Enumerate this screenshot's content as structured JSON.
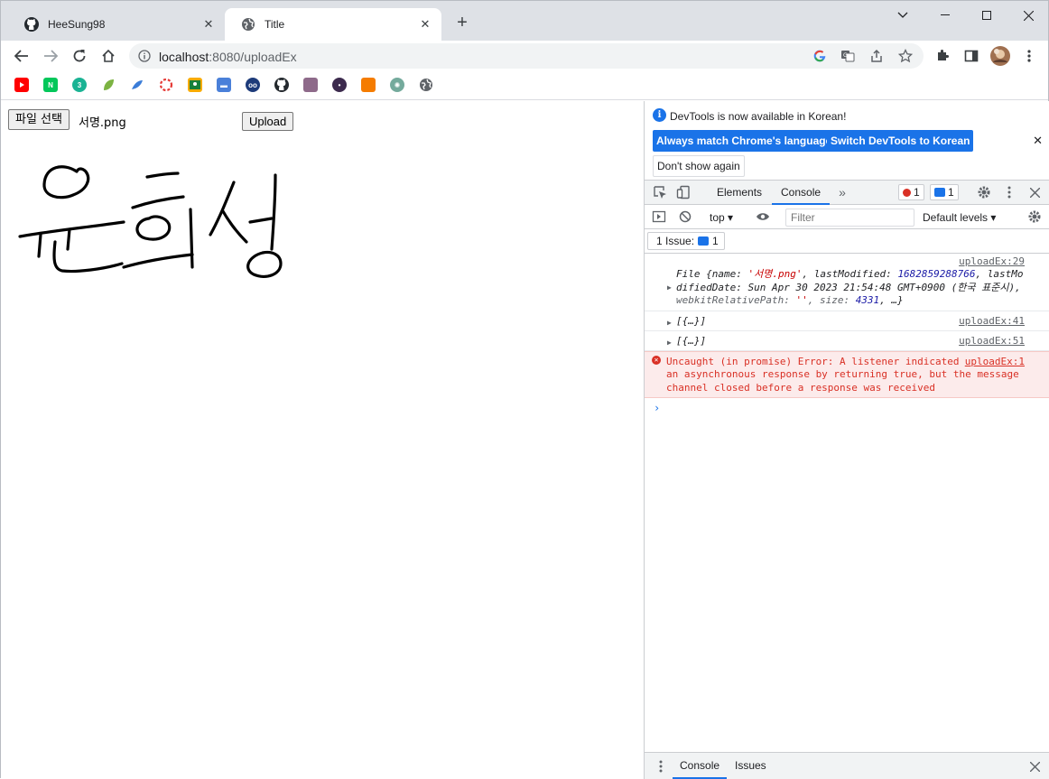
{
  "browser": {
    "tabs": [
      {
        "title": "HeeSung98",
        "active": false,
        "icon": "github-icon"
      },
      {
        "title": "Title",
        "active": true,
        "icon": "globe-icon"
      }
    ],
    "address": {
      "host": "localhost",
      "port_path": ":8080/uploadEx"
    },
    "bookmarks": [
      "youtube-icon",
      "naver-icon",
      "green-circle-icon",
      "leaf-icon",
      "blue-leaf-icon",
      "red-ring-icon",
      "classroom-icon",
      "blue-box-icon",
      "owl-icon",
      "github-icon",
      "photo-icon",
      "avatar-dark-icon",
      "orange-box-icon",
      "chatgpt-icon",
      "globe-icon"
    ]
  },
  "page": {
    "file_button": "파일 선택",
    "file_name": "서명.png",
    "upload_button": "Upload",
    "signature_alt": "윤희성"
  },
  "devtools": {
    "info": {
      "message": "DevTools is now available in Korean!",
      "btn_match": "Always match Chrome's language",
      "btn_switch": "Switch DevTools to Korean",
      "btn_dont_show": "Don't show again"
    },
    "tabs": {
      "elements": "Elements",
      "console": "Console"
    },
    "error_count": "1",
    "info_count": "1",
    "toolbar": {
      "context": "top",
      "filter_placeholder": "Filter",
      "levels": "Default levels"
    },
    "issues_label": "1 Issue:",
    "issues_count": "1",
    "messages": [
      {
        "source": "uploadEx:29",
        "file_line1_a": "File {name: ",
        "file_name": "'서명.png'",
        "file_line1_b": ", lastModified: ",
        "file_lastmodified": "1682859288766",
        "file_line1_c": ", lastMo",
        "file_line2": "difiedDate: Sun Apr 30 2023 21:54:48 GMT+0900 (한국 표준시),",
        "file_line3_a": "webkitRelativePath: ",
        "file_line3_b": "''",
        "file_line3_c": ", size: ",
        "file_size": "4331",
        "file_line3_d": ", …}"
      },
      {
        "source": "uploadEx:41",
        "text": "[{…}]"
      },
      {
        "source": "uploadEx:51",
        "text": "[{…}]"
      }
    ],
    "error": {
      "source": "uploadEx:1",
      "line1": "Uncaught (in promise) Error: A listener indicated",
      "line2": "an asynchronous response by returning true, but the message",
      "line3": "channel closed before a response was received"
    },
    "drawer": {
      "console": "Console",
      "issues": "Issues"
    }
  },
  "colors": {
    "accent": "#1a73e8",
    "error": "#d93025",
    "tabstrip": "#dee1e6"
  }
}
